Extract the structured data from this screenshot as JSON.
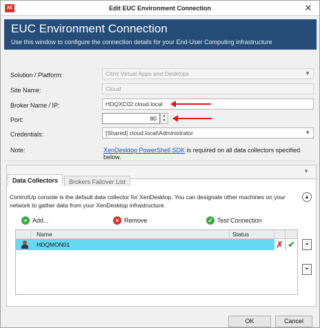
{
  "window": {
    "title": "Edit EUC Environment Connection",
    "app_icon_text": "AE",
    "close_glyph": "✕"
  },
  "banner": {
    "title": "EUC Environment Connection",
    "subtitle": "Use this window to configure the connection details for your End-User Computing infrastructure"
  },
  "form": {
    "solution_label": "Solution / Platform:",
    "solution_value": "Citrix Virtual Apps and Desktops",
    "site_label": "Site Name:",
    "site_value": "Cloud",
    "broker_label": "Broker Name / IP:",
    "broker_value": "HDQXC02.cloud.local",
    "port_label": "Port:",
    "port_value": "80",
    "credentials_label": "Credentials:",
    "credentials_value": "[Shared] cloud.local\\Administrator",
    "note_label": "Note:",
    "note_link": "XenDesktop PowerShell SDK",
    "note_text": " is required on all data collectors specified below."
  },
  "tabs": [
    {
      "label": "Data Collectors",
      "active": true
    },
    {
      "label": "Brokers Failover List",
      "active": false
    }
  ],
  "collectors": {
    "description": "ControlUp console is the default data collector for XenDesktop. You can designate other machines on your network to gather data from your XenDesktop infrastructure.",
    "add_label": "Add...",
    "remove_label": "Remove",
    "test_label": "Test Connection",
    "columns": {
      "name": "Name",
      "status": "Status"
    },
    "rows": [
      {
        "name": "HDQMON01",
        "status": ""
      }
    ]
  },
  "buttons": {
    "ok": "OK",
    "cancel": "Cancel"
  },
  "colors": {
    "banner": "#254d78",
    "selected_row": "#66d8f2",
    "annotation_arrow": "#e01616",
    "link": "#0f54c4"
  },
  "icons": {
    "add": "plus-circle-icon",
    "remove": "x-circle-icon",
    "test": "check-circle-icon",
    "row_user": "user-icon",
    "row_delete": "delete-x-icon",
    "row_ok": "checkmark-icon",
    "scroll_top": "double-chevron-up-icon",
    "scroll_bottom": "double-chevron-down-icon"
  }
}
